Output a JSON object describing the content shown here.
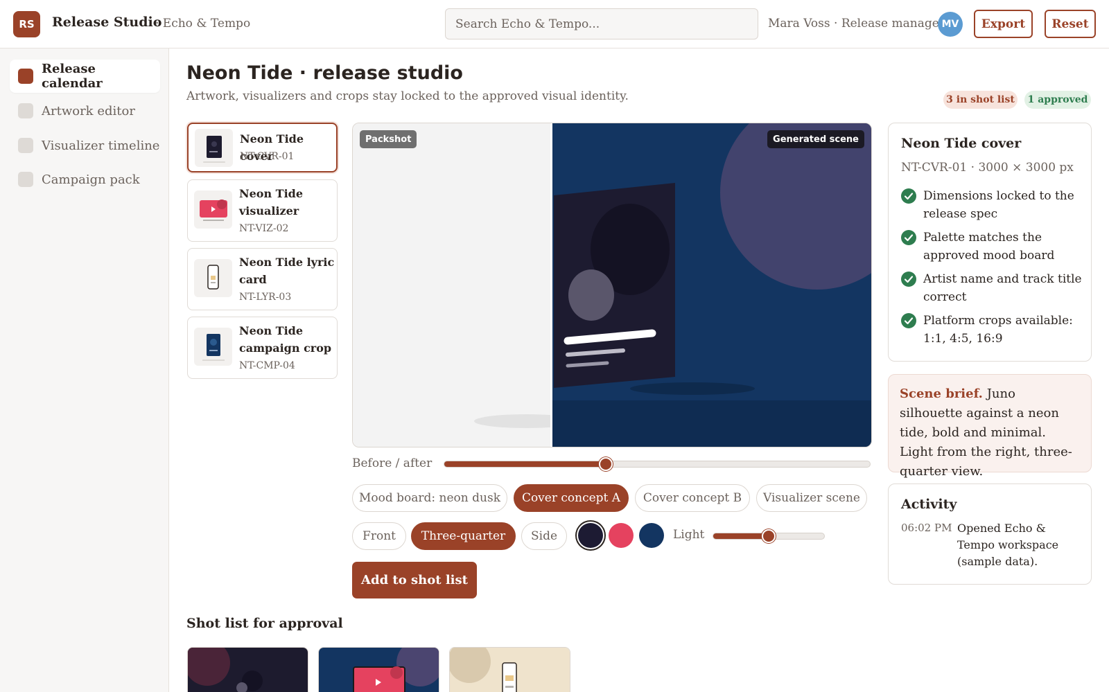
{
  "header": {
    "logo": "RS",
    "app_title": "Release Studio",
    "workspace": "· Echo & Tempo",
    "search_placeholder": "Search Echo & Tempo...",
    "user": "Mara Voss · Release manager",
    "avatar": "MV",
    "export_label": "Export",
    "reset_label": "Reset"
  },
  "sidebar": {
    "items": [
      {
        "label": "Release calendar",
        "active": true
      },
      {
        "label": "Artwork editor",
        "active": false
      },
      {
        "label": "Visualizer timeline",
        "active": false
      },
      {
        "label": "Campaign pack",
        "active": false
      }
    ]
  },
  "main": {
    "title": "Neon Tide · release studio",
    "subtitle": "Artwork, visualizers and crops stay locked to the approved visual identity.",
    "badges": {
      "shot_list": "3 in shot list",
      "approved": "1 approved"
    },
    "assets": [
      {
        "name": "Neon Tide cover",
        "code": "NT-CVR-01",
        "selected": true
      },
      {
        "name": "Neon Tide visualizer",
        "code": "NT-VIZ-02",
        "selected": false
      },
      {
        "name": "Neon Tide lyric card",
        "code": "NT-LYR-03",
        "selected": false
      },
      {
        "name": "Neon Tide campaign crop",
        "code": "NT-CMP-04",
        "selected": false
      }
    ],
    "preview": {
      "left_tag": "Packshot",
      "right_tag": "Generated scene",
      "before_after_label": "Before / after",
      "before_after_value": 0.38
    },
    "scene_chips": [
      {
        "label": "Mood board: neon dusk",
        "on": false
      },
      {
        "label": "Cover concept A",
        "on": true
      },
      {
        "label": "Cover concept B",
        "on": false
      },
      {
        "label": "Visualizer scene",
        "on": false
      }
    ],
    "angle_chips": [
      {
        "label": "Front",
        "on": false
      },
      {
        "label": "Three-quarter",
        "on": true
      },
      {
        "label": "Side",
        "on": false
      }
    ],
    "swatches": [
      {
        "color": "#1d1b33",
        "selected": true
      },
      {
        "color": "#e5425f",
        "selected": false
      },
      {
        "color": "#133561",
        "selected": false
      }
    ],
    "light_label": "Light",
    "light_value": 0.5,
    "add_button": "Add to shot list",
    "shot_list_title": "Shot list for approval"
  },
  "details": {
    "title": "Neon Tide cover",
    "subtitle": "NT-CVR-01 · 3000 × 3000 px",
    "checks": [
      "Dimensions locked to the release spec",
      "Palette matches the approved mood board",
      "Artist name and track title correct",
      "Platform crops available: 1:1, 4:5, 16:9"
    ]
  },
  "brief": {
    "label": "Scene brief.",
    "text": "Juno silhouette against a neon tide, bold and minimal. Light from the right, three-quarter view."
  },
  "activity": {
    "title": "Activity",
    "time": "06:02 PM",
    "text": "Opened Echo & Tempo workspace (sample data)."
  },
  "colors": {
    "accent": "#9a4228",
    "success": "#2e7d4f",
    "scene_bg": "#133561"
  }
}
